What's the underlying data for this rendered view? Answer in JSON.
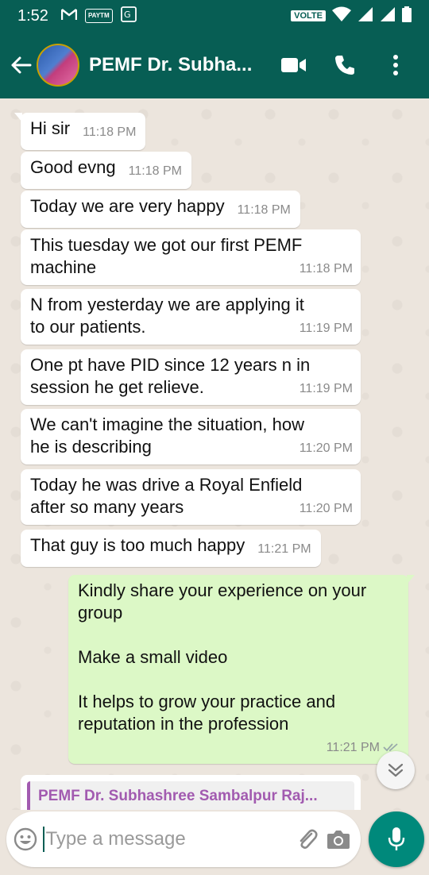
{
  "status_bar": {
    "time": "1:52",
    "icons": [
      "gmail-icon",
      "paytm-icon",
      "translate-icon"
    ],
    "paytm_label": "PAYTM",
    "volte_label": "VOLTE"
  },
  "header": {
    "title": "PEMF Dr. Subha...",
    "avatar": "contact-avatar"
  },
  "messages": [
    {
      "text": "Hi sir",
      "time": "11:18 PM",
      "direction": "in"
    },
    {
      "text": "Good evng",
      "time": "11:18 PM",
      "direction": "in"
    },
    {
      "text": "Today we are very happy",
      "time": "11:18 PM",
      "direction": "in"
    },
    {
      "text": "This tuesday we got our first PEMF\nmachine",
      "time": "11:18 PM",
      "direction": "in"
    },
    {
      "text": "N from yesterday we are applying it\nto our patients.",
      "time": "11:19 PM",
      "direction": "in"
    },
    {
      "text": "One pt have PID since 12 years n in\nsession he get relieve.",
      "time": "11:19 PM",
      "direction": "in"
    },
    {
      "text": "We can't imagine the situation, how\nhe is describing",
      "time": "11:20 PM",
      "direction": "in"
    },
    {
      "text": "Today he was drive a Royal Enfield\nafter so many years",
      "time": "11:20 PM",
      "direction": "in"
    },
    {
      "text": "That guy is too much happy",
      "time": "11:21 PM",
      "direction": "in"
    },
    {
      "text": "Kindly share your experience on your\ngroup\n\nMake a small video\n\nIt helps to grow your practice and\nreputation in the profession",
      "time": "11:21 PM",
      "direction": "out"
    }
  ],
  "quoted_message": {
    "sender": "PEMF Dr. Subhashree Sambalpur Raj..."
  },
  "composer": {
    "placeholder": "Type a message"
  },
  "colors": {
    "header": "#075e54",
    "outgoing_bubble": "#dcf8c6",
    "mic_button": "#00897b",
    "quote_accent": "#a25bb0"
  }
}
